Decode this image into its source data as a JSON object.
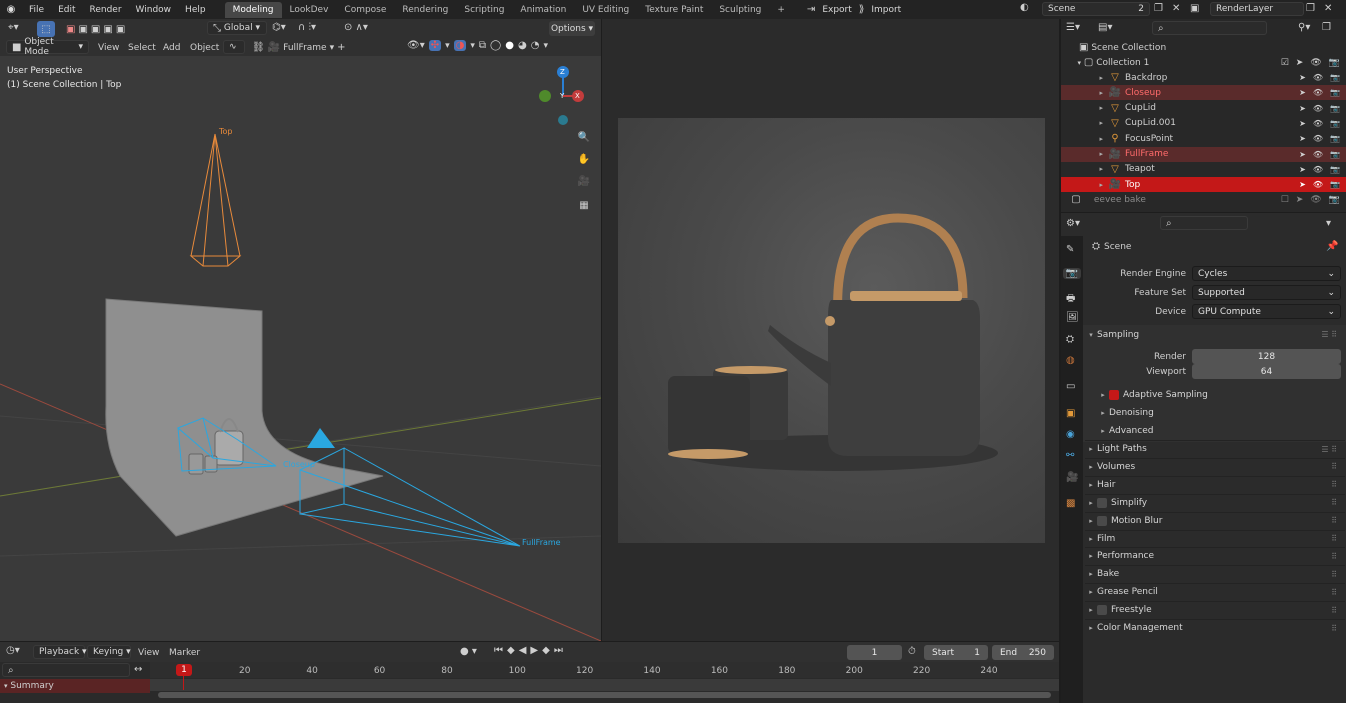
{
  "topbar": {
    "menus": [
      "File",
      "Edit",
      "Render",
      "Window",
      "Help"
    ],
    "workspaces": [
      "Modeling",
      "LookDev",
      "Compose",
      "Rendering",
      "Scripting",
      "Animation",
      "UV Editing",
      "Texture Paint",
      "Sculpting"
    ],
    "active_workspace": "Modeling",
    "add_tab": "+",
    "export": "Export",
    "import": "Import",
    "scene": "Scene",
    "scene_users": "2",
    "render_layer": "RenderLayer"
  },
  "viewport": {
    "transform_orientation": "Global",
    "options": "Options",
    "mode": "Object Mode",
    "menus": [
      "View",
      "Select",
      "Add",
      "Object"
    ],
    "camera_name": "FullFrame",
    "overlay_title": "User Perspective",
    "overlay_subtitle": "(1) Scene Collection | Top",
    "camera_labels": {
      "top": "Top",
      "closeup": "Closeup",
      "fullframe": "FullFrame"
    },
    "gizmo": {
      "z": "Z",
      "y": "Y",
      "x": "X"
    }
  },
  "outliner": {
    "root": "Scene Collection",
    "collection": "Collection 1",
    "items": [
      {
        "name": "Backdrop",
        "state": "normal"
      },
      {
        "name": "Closeup",
        "state": "highlight"
      },
      {
        "name": "CupLid",
        "state": "normal"
      },
      {
        "name": "CupLid.001",
        "state": "normal"
      },
      {
        "name": "FocusPoint",
        "state": "normal"
      },
      {
        "name": "FullFrame",
        "state": "highlight"
      },
      {
        "name": "Teapot",
        "state": "normal"
      },
      {
        "name": "Top",
        "state": "selected"
      }
    ],
    "extra": "eevee bake"
  },
  "properties": {
    "context": "Scene",
    "render_engine_label": "Render Engine",
    "render_engine": "Cycles",
    "feature_set_label": "Feature Set",
    "feature_set": "Supported",
    "device_label": "Device",
    "device": "GPU Compute",
    "sampling": "Sampling",
    "render_label": "Render",
    "render_samples": "128",
    "viewport_label": "Viewport",
    "viewport_samples": "64",
    "adaptive_sampling": "Adaptive Sampling",
    "denoising": "Denoising",
    "advanced": "Advanced",
    "panels": [
      "Light Paths",
      "Volumes",
      "Hair",
      "Simplify",
      "Motion Blur",
      "Film",
      "Performance",
      "Bake",
      "Grease Pencil",
      "Freestyle",
      "Color Management"
    ]
  },
  "timeline": {
    "menus": [
      "Playback",
      "Keying",
      "View",
      "Marker"
    ],
    "current_frame": "1",
    "start_label": "Start",
    "start": "1",
    "end_label": "End",
    "end": "250",
    "ticks": [
      "1",
      "20",
      "40",
      "60",
      "80",
      "100",
      "120",
      "140",
      "160",
      "180",
      "200",
      "220",
      "240"
    ],
    "summary": "Summary"
  },
  "colors": {
    "accent": "#4772b3",
    "selected": "#c41818",
    "camera": "#2aa7e0",
    "top_camera": "#e88a3a"
  }
}
